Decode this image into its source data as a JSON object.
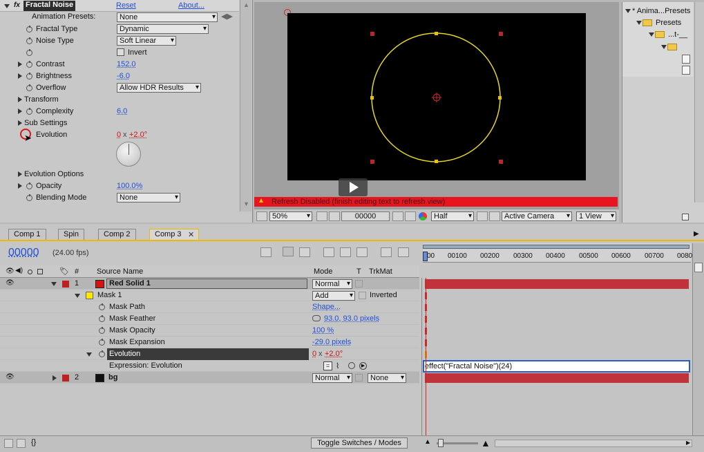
{
  "effects_panel": {
    "effect_name": "Fractal Noise",
    "reset": "Reset",
    "about": "About...",
    "anim_presets_label": "Animation Presets:",
    "anim_presets_value": "None",
    "props": {
      "fractal_type": {
        "label": "Fractal Type",
        "value": "Dynamic"
      },
      "noise_type": {
        "label": "Noise Type",
        "value": "Soft Linear"
      },
      "invert": {
        "label": "Invert"
      },
      "contrast": {
        "label": "Contrast",
        "value": "152.0"
      },
      "brightness": {
        "label": "Brightness",
        "value": "-6.0"
      },
      "overflow": {
        "label": "Overflow",
        "value": "Allow HDR Results"
      },
      "transform": {
        "label": "Transform"
      },
      "complexity": {
        "label": "Complexity",
        "value": "6.0"
      },
      "sub_settings": {
        "label": "Sub Settings"
      },
      "evolution": {
        "label": "Evolution",
        "rev": "0",
        "x": "x",
        "deg": "+2.0°"
      },
      "evolution_options": {
        "label": "Evolution Options"
      },
      "opacity": {
        "label": "Opacity",
        "value": "100.0%"
      },
      "blending_mode": {
        "label": "Blending Mode",
        "value": "None"
      }
    }
  },
  "viewer": {
    "warning": "Refresh Disabled (finish editing text to refresh view)",
    "zoom": "50%",
    "timecode": "00000",
    "resolution": "Half",
    "camera": "Active Camera",
    "views": "1 View"
  },
  "project_panel": {
    "items": [
      "* Anima...Presets",
      "Presets",
      "...t-__",
      "",
      "",
      ""
    ]
  },
  "timeline": {
    "tabs": [
      "Comp 1",
      "Spin",
      "Comp 2",
      "Comp 3"
    ],
    "active_tab": "Comp 3",
    "time": "00000",
    "fps": "(24.00 fps)",
    "headers": {
      "num": "#",
      "source": "Source Name",
      "mode": "Mode",
      "t": "T",
      "trkmat": "TrkMat"
    },
    "ruler": [
      "00",
      "00100",
      "00200",
      "00300",
      "00400",
      "00500",
      "00600",
      "00700",
      "0080"
    ],
    "layers": {
      "l1": {
        "num": "1",
        "name": "Red Solid 1",
        "mode": "Normal",
        "color": "#c81414"
      },
      "mask1": {
        "name": "Mask 1",
        "mode": "Add",
        "inverted": "Inverted"
      },
      "mask_path": {
        "label": "Mask Path",
        "value": "Shape..."
      },
      "mask_feather": {
        "label": "Mask Feather",
        "value": "93.0, 93.0 pixels"
      },
      "mask_opacity": {
        "label": "Mask Opacity",
        "value": "100 %"
      },
      "mask_expansion": {
        "label": "Mask Expansion",
        "value": "-29.0 pixels"
      },
      "evolution": {
        "label": "Evolution",
        "rev": "0",
        "x": "x",
        "deg": "+2.0°"
      },
      "expression": {
        "label": "Expression: Evolution",
        "code": "effect(\"Fractal Noise\")(24)"
      },
      "l2": {
        "num": "2",
        "name": "bg",
        "mode": "Normal",
        "trkmat": "None",
        "color": "#111111"
      }
    },
    "toggle_label": "Toggle Switches / Modes"
  },
  "colors": {
    "accent": "#f0b800",
    "warning": "#e8141e",
    "layer_bar": "#c0333a",
    "mask_stroke": "#e8d820"
  }
}
